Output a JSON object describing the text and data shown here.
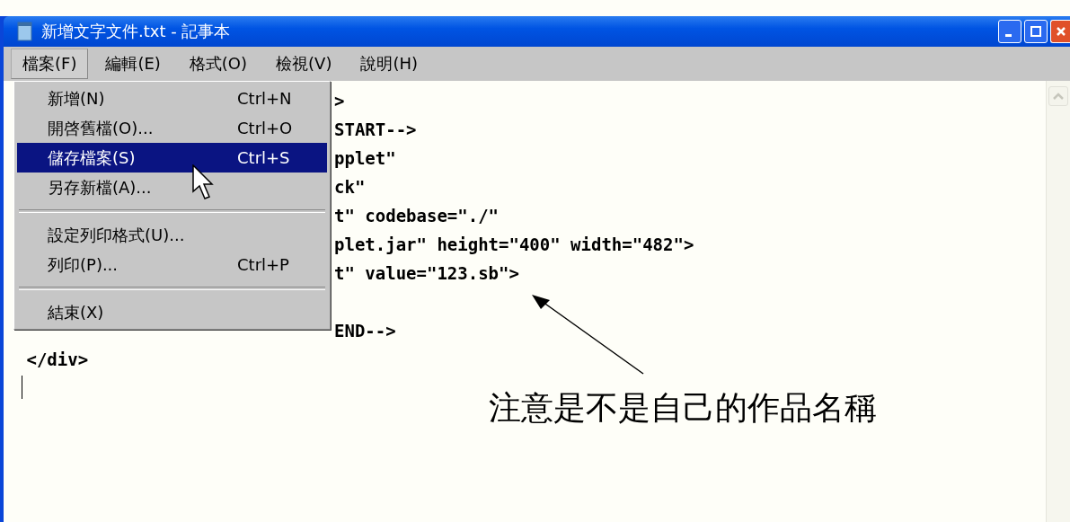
{
  "window": {
    "title": "新增文字文件.txt - 記事本"
  },
  "menu_bar": [
    {
      "label": "檔案(F)",
      "selected": true
    },
    {
      "label": "編輯(E)",
      "selected": false
    },
    {
      "label": "格式(O)",
      "selected": false
    },
    {
      "label": "檢視(V)",
      "selected": false
    },
    {
      "label": "說明(H)",
      "selected": false
    }
  ],
  "file_menu": [
    {
      "kind": "item",
      "label": "新增(N)",
      "shortcut": "Ctrl+N",
      "selected": false
    },
    {
      "kind": "item",
      "label": "開啓舊檔(O)...",
      "shortcut": "Ctrl+O",
      "selected": false
    },
    {
      "kind": "item",
      "label": "儲存檔案(S)",
      "shortcut": "Ctrl+S",
      "selected": true
    },
    {
      "kind": "item",
      "label": "另存新檔(A)...",
      "selected": false
    },
    {
      "kind": "separator"
    },
    {
      "kind": "item",
      "label": "設定列印格式(U)...",
      "selected": false
    },
    {
      "kind": "item",
      "label": "列印(P)...",
      "shortcut": "Ctrl+P",
      "selected": false
    },
    {
      "kind": "separator"
    },
    {
      "kind": "item",
      "label": "結束(X)",
      "selected": false
    }
  ],
  "editor": {
    "lines": [
      {
        "kind": "clipped",
        "text": ">"
      },
      {
        "kind": "clipped",
        "text": "START-->"
      },
      {
        "kind": "clipped",
        "text": "pplet\""
      },
      {
        "kind": "clipped",
        "text": "ck\""
      },
      {
        "kind": "clipped",
        "text": "t\" codebase=\"./\""
      },
      {
        "kind": "clipped",
        "text": "plet.jar\" height=\"400\" width=\"482\">"
      },
      {
        "kind": "clipped",
        "text": "t\" value=\"123.sb\">"
      },
      {
        "kind": "clipped"
      },
      {
        "kind": "clipped",
        "text": "END-->"
      },
      {
        "kind": "full",
        "text": " </div>"
      }
    ]
  },
  "annotation": {
    "text": "注意是不是自己的作品名稱"
  }
}
